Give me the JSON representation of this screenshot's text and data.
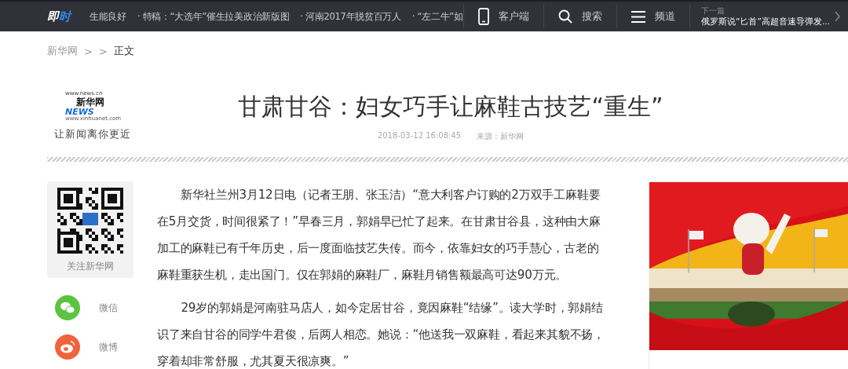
{
  "top_bar": {
    "logo": [
      "即",
      "时"
    ],
    "ticker": [
      "生能良好",
      "· 特稿：“大选年”催生拉美政治新版图",
      "· 河南2017年脱贫百万人",
      "· “左二牛”如"
    ],
    "links": [
      {
        "kind": "phone",
        "label": "客户端"
      },
      {
        "kind": "search",
        "label": "搜索"
      },
      {
        "kind": "menu",
        "label": "频道"
      }
    ],
    "next": {
      "label": "下一篇",
      "title": "俄罗斯说“匕首”高超音速导弹发..."
    }
  },
  "breadcrumb": [
    "新华网",
    ">",
    ">",
    "正文"
  ],
  "logo": {
    "url": "www.news.cn",
    "name": "新华网",
    "news": "NEWS",
    "site": "www.xinhuanet.com",
    "slogan": "让新闻离你更近"
  },
  "article": {
    "title": "甘肃甘谷：妇女巧手让麻鞋古技艺“重生”",
    "time": "2018-03-12 16:08:45",
    "source": "来源：新华网",
    "paragraphs": [
      "新华社兰州3月12日电（记者王朋、张玉洁）“意大利客户订购的2万双手工麻鞋要在5月交货，时间很紧了！”早春三月，郭娟早已忙了起来。在甘肃甘谷县，这种由大麻加工的麻鞋已有千年历史，后一度面临技艺失传。而今，依靠妇女的巧手慧心，古老的麻鞋重获生机，走出国门。仅在郭娟的麻鞋厂，麻鞋月销售额最高可达90万元。",
      "29岁的郭娟是河南驻马店人，如今定居甘谷，竟因麻鞋“结缘”。读大学时，郭娟结识了来自甘谷的同学牛君俊，后两人相恋。她说：“他送我一双麻鞋，看起来其貌不扬，穿着却非常舒服，尤其夏天很凉爽。”"
    ]
  },
  "side": {
    "qr_label": "关注新华网",
    "share": [
      {
        "kind": "wechat",
        "label": "微信",
        "color": "#5cc341"
      },
      {
        "kind": "weibo",
        "label": "微博",
        "color": "#f0633c"
      }
    ]
  }
}
